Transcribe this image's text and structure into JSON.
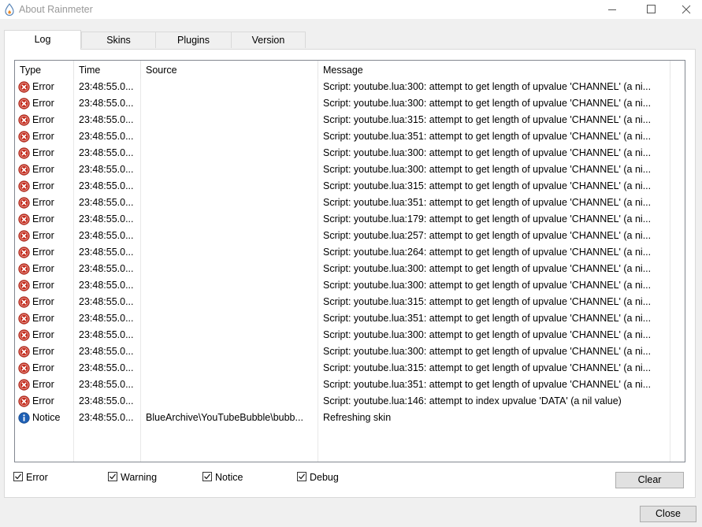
{
  "window": {
    "title": "About Rainmeter",
    "controls": {
      "minimize": "minimize-icon",
      "maximize": "maximize-icon",
      "close": "close-icon"
    }
  },
  "tabs": [
    {
      "label": "Log",
      "active": true
    },
    {
      "label": "Skins",
      "active": false
    },
    {
      "label": "Plugins",
      "active": false
    },
    {
      "label": "Version",
      "active": false
    }
  ],
  "log": {
    "columns": [
      "Type",
      "Time",
      "Source",
      "Message"
    ],
    "rows": [
      {
        "type": "Error",
        "icon": "error-icon",
        "time": "23:48:55.0...",
        "source": "",
        "message": "Script: youtube.lua:300: attempt to get length of upvalue 'CHANNEL' (a ni..."
      },
      {
        "type": "Error",
        "icon": "error-icon",
        "time": "23:48:55.0...",
        "source": "",
        "message": "Script: youtube.lua:300: attempt to get length of upvalue 'CHANNEL' (a ni..."
      },
      {
        "type": "Error",
        "icon": "error-icon",
        "time": "23:48:55.0...",
        "source": "",
        "message": "Script: youtube.lua:315: attempt to get length of upvalue 'CHANNEL' (a ni..."
      },
      {
        "type": "Error",
        "icon": "error-icon",
        "time": "23:48:55.0...",
        "source": "",
        "message": "Script: youtube.lua:351: attempt to get length of upvalue 'CHANNEL' (a ni..."
      },
      {
        "type": "Error",
        "icon": "error-icon",
        "time": "23:48:55.0...",
        "source": "",
        "message": "Script: youtube.lua:300: attempt to get length of upvalue 'CHANNEL' (a ni..."
      },
      {
        "type": "Error",
        "icon": "error-icon",
        "time": "23:48:55.0...",
        "source": "",
        "message": "Script: youtube.lua:300: attempt to get length of upvalue 'CHANNEL' (a ni..."
      },
      {
        "type": "Error",
        "icon": "error-icon",
        "time": "23:48:55.0...",
        "source": "",
        "message": "Script: youtube.lua:315: attempt to get length of upvalue 'CHANNEL' (a ni..."
      },
      {
        "type": "Error",
        "icon": "error-icon",
        "time": "23:48:55.0...",
        "source": "",
        "message": "Script: youtube.lua:351: attempt to get length of upvalue 'CHANNEL' (a ni..."
      },
      {
        "type": "Error",
        "icon": "error-icon",
        "time": "23:48:55.0...",
        "source": "",
        "message": "Script: youtube.lua:179: attempt to get length of upvalue 'CHANNEL' (a ni..."
      },
      {
        "type": "Error",
        "icon": "error-icon",
        "time": "23:48:55.0...",
        "source": "",
        "message": "Script: youtube.lua:257: attempt to get length of upvalue 'CHANNEL' (a ni..."
      },
      {
        "type": "Error",
        "icon": "error-icon",
        "time": "23:48:55.0...",
        "source": "",
        "message": "Script: youtube.lua:264: attempt to get length of upvalue 'CHANNEL' (a ni..."
      },
      {
        "type": "Error",
        "icon": "error-icon",
        "time": "23:48:55.0...",
        "source": "",
        "message": "Script: youtube.lua:300: attempt to get length of upvalue 'CHANNEL' (a ni..."
      },
      {
        "type": "Error",
        "icon": "error-icon",
        "time": "23:48:55.0...",
        "source": "",
        "message": "Script: youtube.lua:300: attempt to get length of upvalue 'CHANNEL' (a ni..."
      },
      {
        "type": "Error",
        "icon": "error-icon",
        "time": "23:48:55.0...",
        "source": "",
        "message": "Script: youtube.lua:315: attempt to get length of upvalue 'CHANNEL' (a ni..."
      },
      {
        "type": "Error",
        "icon": "error-icon",
        "time": "23:48:55.0...",
        "source": "",
        "message": "Script: youtube.lua:351: attempt to get length of upvalue 'CHANNEL' (a ni..."
      },
      {
        "type": "Error",
        "icon": "error-icon",
        "time": "23:48:55.0...",
        "source": "",
        "message": "Script: youtube.lua:300: attempt to get length of upvalue 'CHANNEL' (a ni..."
      },
      {
        "type": "Error",
        "icon": "error-icon",
        "time": "23:48:55.0...",
        "source": "",
        "message": "Script: youtube.lua:300: attempt to get length of upvalue 'CHANNEL' (a ni..."
      },
      {
        "type": "Error",
        "icon": "error-icon",
        "time": "23:48:55.0...",
        "source": "",
        "message": "Script: youtube.lua:315: attempt to get length of upvalue 'CHANNEL' (a ni..."
      },
      {
        "type": "Error",
        "icon": "error-icon",
        "time": "23:48:55.0...",
        "source": "",
        "message": "Script: youtube.lua:351: attempt to get length of upvalue 'CHANNEL' (a ni..."
      },
      {
        "type": "Error",
        "icon": "error-icon",
        "time": "23:48:55.0...",
        "source": "",
        "message": "Script: youtube.lua:146: attempt to index upvalue 'DATA' (a nil value)"
      },
      {
        "type": "Notice",
        "icon": "info-icon",
        "time": "23:48:55.0...",
        "source": "BlueArchive\\YouTubeBubble\\bubb...",
        "message": "Refreshing skin"
      }
    ]
  },
  "filters": [
    {
      "label": "Error",
      "checked": true
    },
    {
      "label": "Warning",
      "checked": true
    },
    {
      "label": "Notice",
      "checked": true
    },
    {
      "label": "Debug",
      "checked": true
    }
  ],
  "buttons": {
    "clear": "Clear",
    "close": "Close"
  },
  "colors": {
    "error": "#c42b1c",
    "notice": "#1e5fb4",
    "window_bg": "#f0f0f0"
  }
}
